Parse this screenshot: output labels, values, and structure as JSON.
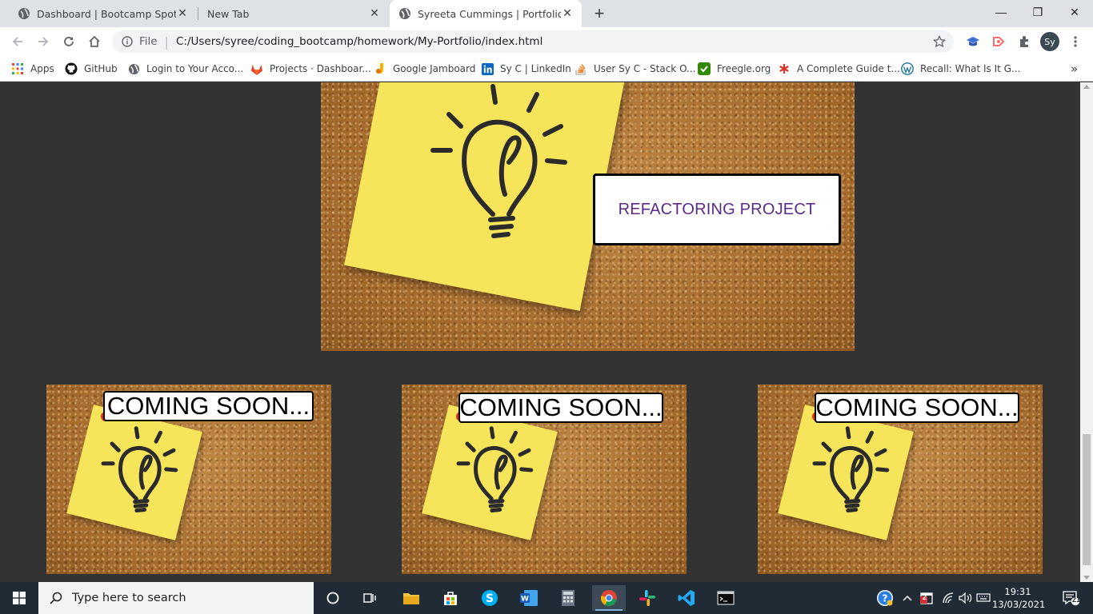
{
  "browser": {
    "tabs": [
      {
        "title": "Dashboard | Bootcamp Spot",
        "active": false
      },
      {
        "title": "New Tab",
        "active": false
      },
      {
        "title": "Syreeta Cummings | Portfolio",
        "active": true
      }
    ],
    "new_tab_symbol": "+",
    "close_symbol": "✕",
    "window_controls": {
      "minimize": "—",
      "maximize": "❐",
      "close": "✕"
    },
    "omnibox": {
      "file_label": "File",
      "url": "C:/Users/syree/coding_bootcamp/homework/My-Portfolio/index.html"
    },
    "profile_initials": "Sy",
    "bookmarks": [
      {
        "label": "Apps",
        "icon": "apps-grid-icon"
      },
      {
        "label": "GitHub",
        "icon": "github-icon"
      },
      {
        "label": "Login to Your Acco...",
        "icon": "globe-icon"
      },
      {
        "label": "Projects · Dashboar...",
        "icon": "gitlab-icon"
      },
      {
        "label": "Google Jamboard",
        "icon": "jamboard-icon"
      },
      {
        "label": "Sy C | LinkedIn",
        "icon": "linkedin-icon"
      },
      {
        "label": "User Sy C - Stack O...",
        "icon": "stackoverflow-icon"
      },
      {
        "label": "Freegle.org",
        "icon": "freegle-icon"
      },
      {
        "label": "A Complete Guide t...",
        "icon": "asterisk-icon"
      },
      {
        "label": "Recall: What Is It G...",
        "icon": "wordpress-icon"
      }
    ],
    "bookmarks_overflow": "»"
  },
  "page": {
    "hero_label": "REFACTORING PROJECT",
    "cards": [
      {
        "label": "COMING SOON..."
      },
      {
        "label": "COMING SOON..."
      },
      {
        "label": "COMING SOON..."
      }
    ]
  },
  "taskbar": {
    "search_placeholder": "Type here to search",
    "time": "19:31",
    "date": "13/03/2021",
    "notification_count": "21",
    "weather_badge": "2"
  },
  "colors": {
    "page_background": "#333333",
    "hero_label_text": "#5b2a86",
    "sticky_note": "#f6e45a",
    "taskbar": "#202b36"
  }
}
